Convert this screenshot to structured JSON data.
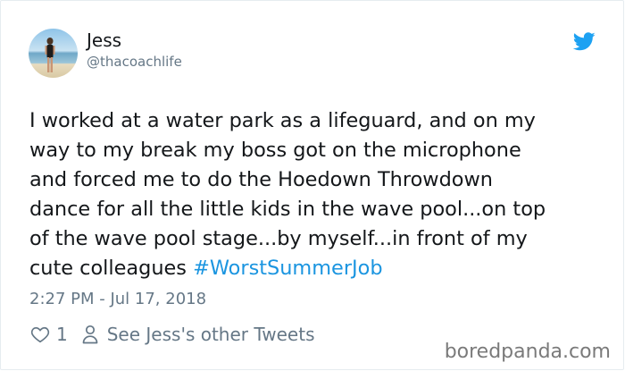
{
  "author": {
    "name": "Jess",
    "handle": "@thacoachlife"
  },
  "tweet": {
    "lines": [
      "I worked at a water park as a lifeguard, and on my",
      "way to my break my boss got on the microphone",
      "and forced me to do the Hoedown Throwdown",
      "dance for all the little kids in the wave pool...on top",
      "of the wave pool stage...by myself...in front of my"
    ],
    "last_line_text": "cute colleagues ",
    "hashtag": "#WorstSummerJob",
    "timestamp": "2:27 PM - Jul 17, 2018"
  },
  "actions": {
    "like_count": "1",
    "see_more_label": "See Jess's other Tweets"
  },
  "watermark": "boredpanda.com",
  "colors": {
    "link": "#1b95e0",
    "muted": "#657786",
    "twitter_blue": "#1da1f2"
  },
  "icons": {
    "brand": "twitter-bird-icon",
    "like": "heart-icon",
    "profile": "person-icon"
  }
}
